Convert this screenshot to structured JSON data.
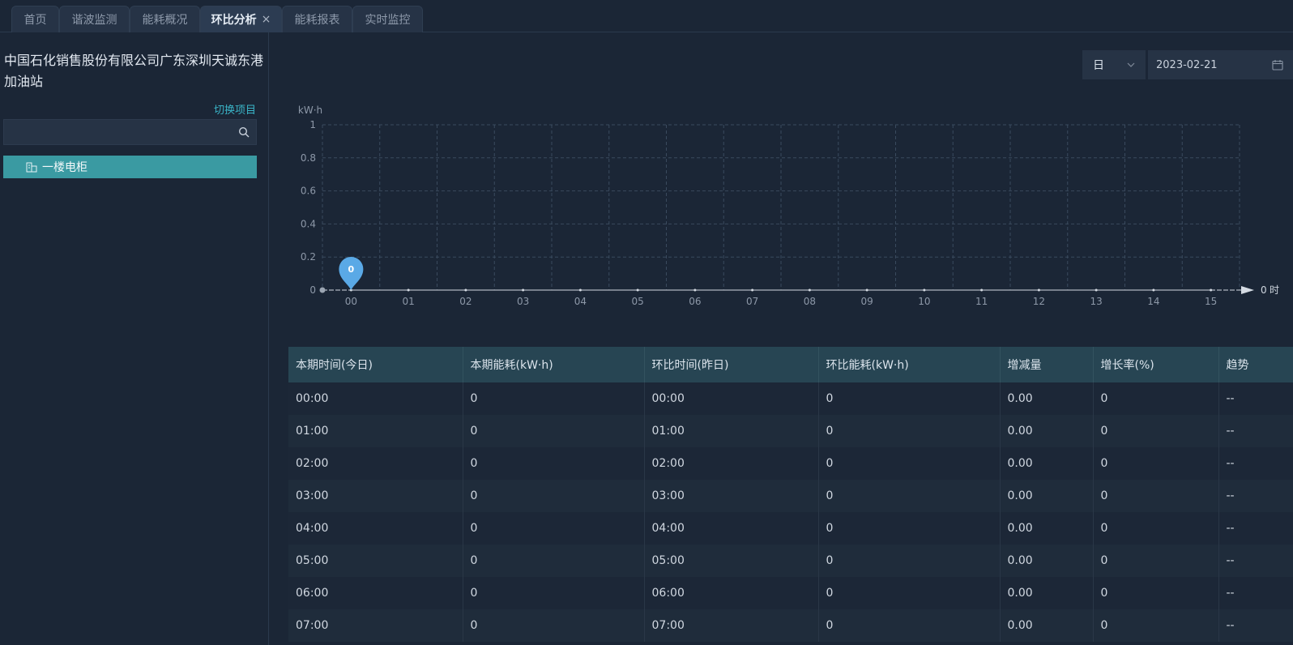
{
  "tabs": [
    {
      "label": "首页",
      "active": false
    },
    {
      "label": "谐波监测",
      "active": false
    },
    {
      "label": "能耗概况",
      "active": false
    },
    {
      "label": "环比分析",
      "active": true
    },
    {
      "label": "能耗报表",
      "active": false
    },
    {
      "label": "实时监控",
      "active": false
    }
  ],
  "sidebar": {
    "project_name": "中国石化销售股份有限公司广东深圳天诚东港加油站",
    "switch_label": "切换项目",
    "search_value": "",
    "tree_items": [
      {
        "label": "一楼电柜",
        "selected": true
      }
    ]
  },
  "toolbar": {
    "period": "日",
    "date": "2023-02-21"
  },
  "chart_data": {
    "type": "line",
    "ylabel": "kW·h",
    "x_unit": "时",
    "x_start_label": "0",
    "categories": [
      "00",
      "01",
      "02",
      "03",
      "04",
      "05",
      "06",
      "07",
      "08",
      "09",
      "10",
      "11",
      "12",
      "13",
      "14",
      "15"
    ],
    "y_ticks": [
      "0",
      "0.2",
      "0.4",
      "0.6",
      "0.8",
      "1"
    ],
    "ylim": [
      0,
      1
    ],
    "series": [
      {
        "values": [
          0,
          0,
          0,
          0,
          0,
          0,
          0,
          0,
          0,
          0,
          0,
          0,
          0,
          0,
          0,
          0
        ]
      }
    ],
    "marker": {
      "category": "00",
      "value": 0,
      "label": "0"
    },
    "grid": true,
    "colors": {
      "marker": "#5aa9e6",
      "line": "#d5dbe3",
      "grid": "#3a4a5e",
      "axis_text": "#8d98a8"
    }
  },
  "table": {
    "headers": [
      "本期时间(今日)",
      "本期能耗(kW·h)",
      "环比时间(昨日)",
      "环比能耗(kW·h)",
      "增减量",
      "增长率(%)",
      "趋势"
    ],
    "rows": [
      [
        "00:00",
        "0",
        "00:00",
        "0",
        "0.00",
        "0",
        "--"
      ],
      [
        "01:00",
        "0",
        "01:00",
        "0",
        "0.00",
        "0",
        "--"
      ],
      [
        "02:00",
        "0",
        "02:00",
        "0",
        "0.00",
        "0",
        "--"
      ],
      [
        "03:00",
        "0",
        "03:00",
        "0",
        "0.00",
        "0",
        "--"
      ],
      [
        "04:00",
        "0",
        "04:00",
        "0",
        "0.00",
        "0",
        "--"
      ],
      [
        "05:00",
        "0",
        "05:00",
        "0",
        "0.00",
        "0",
        "--"
      ],
      [
        "06:00",
        "0",
        "06:00",
        "0",
        "0.00",
        "0",
        "--"
      ],
      [
        "07:00",
        "0",
        "07:00",
        "0",
        "0.00",
        "0",
        "--"
      ]
    ]
  }
}
